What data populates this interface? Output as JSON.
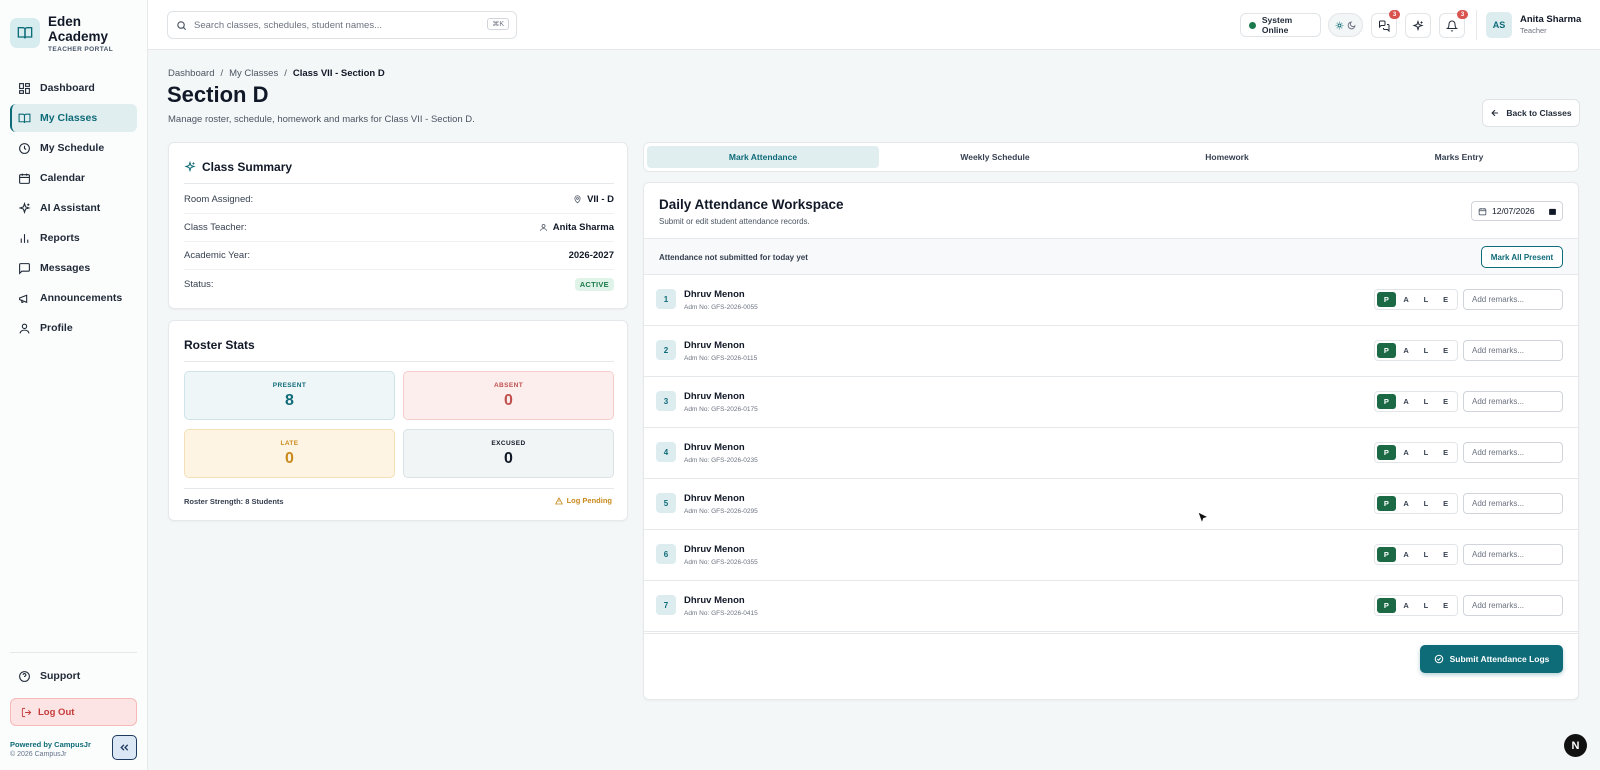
{
  "brand": {
    "name_line1": "Eden",
    "name_line2": "Academy",
    "subtitle": "TEACHER PORTAL"
  },
  "sidebar": {
    "items": [
      {
        "label": "Dashboard",
        "icon": "grid-icon",
        "active": false
      },
      {
        "label": "My Classes",
        "icon": "book-icon",
        "active": true
      },
      {
        "label": "My Schedule",
        "icon": "clock-icon",
        "active": false
      },
      {
        "label": "Calendar",
        "icon": "calendar-icon",
        "active": false
      },
      {
        "label": "AI Assistant",
        "icon": "sparkles-icon",
        "active": false
      },
      {
        "label": "Reports",
        "icon": "bar-chart-icon",
        "active": false
      },
      {
        "label": "Messages",
        "icon": "message-icon",
        "active": false
      },
      {
        "label": "Announcements",
        "icon": "megaphone-icon",
        "active": false
      },
      {
        "label": "Profile",
        "icon": "user-icon",
        "active": false
      }
    ],
    "support": "Support",
    "logout": "Log Out",
    "powered": "Powered by CampusJr",
    "copyright": "© 2026 CampusJr"
  },
  "topbar": {
    "search_placeholder": "Search classes, schedules, student names...",
    "shortcut": "⌘K",
    "system_status": "System Online",
    "messages_badge": "3",
    "notifications_badge": "3",
    "user": {
      "initials": "AS",
      "name": "Anita Sharma",
      "role": "Teacher"
    }
  },
  "page": {
    "breadcrumbs": [
      "Dashboard",
      "My Classes",
      "Class VII - Section D"
    ],
    "title": "Section D",
    "subtitle": "Manage roster, schedule, homework and marks for Class VII - Section D.",
    "back_button": "Back to Classes"
  },
  "class_summary": {
    "title": "Class Summary",
    "rows": [
      {
        "label": "Room Assigned:",
        "value": "VII - D"
      },
      {
        "label": "Class Teacher:",
        "value": "Anita Sharma"
      },
      {
        "label": "Academic Year:",
        "value": "2026-2027"
      },
      {
        "label": "Status:",
        "value": "ACTIVE"
      }
    ]
  },
  "roster_stats": {
    "title": "Roster Stats",
    "present": {
      "label": "PRESENT",
      "value": "8"
    },
    "absent": {
      "label": "ABSENT",
      "value": "0"
    },
    "late": {
      "label": "LATE",
      "value": "0"
    },
    "excused": {
      "label": "EXCUSED",
      "value": "0"
    },
    "strength": "Roster Strength: 8 Students",
    "log_status": "Log Pending"
  },
  "tabs": [
    {
      "label": "Mark Attendance",
      "active": true
    },
    {
      "label": "Weekly Schedule",
      "active": false
    },
    {
      "label": "Homework",
      "active": false
    },
    {
      "label": "Marks Entry",
      "active": false
    }
  ],
  "workspace": {
    "title": "Daily Attendance Workspace",
    "subtitle": "Submit or edit student attendance records.",
    "date": "12/07/2026",
    "notice": "Attendance not submitted for today yet",
    "mark_all": "Mark All Present",
    "status_options": [
      "P",
      "A",
      "L",
      "E"
    ],
    "remarks_placeholder": "Add remarks...",
    "submit": "Submit Attendance Logs",
    "students": [
      {
        "num": "1",
        "name": "Dhruv Menon",
        "adm": "Adm No: GFS-2026-0055",
        "status": "P"
      },
      {
        "num": "2",
        "name": "Dhruv Menon",
        "adm": "Adm No: GFS-2026-0115",
        "status": "P"
      },
      {
        "num": "3",
        "name": "Dhruv Menon",
        "adm": "Adm No: GFS-2026-0175",
        "status": "P"
      },
      {
        "num": "4",
        "name": "Dhruv Menon",
        "adm": "Adm No: GFS-2026-0235",
        "status": "P"
      },
      {
        "num": "5",
        "name": "Dhruv Menon",
        "adm": "Adm No: GFS-2026-0295",
        "status": "P"
      },
      {
        "num": "6",
        "name": "Dhruv Menon",
        "adm": "Adm No: GFS-2026-0355",
        "status": "P"
      },
      {
        "num": "7",
        "name": "Dhruv Menon",
        "adm": "Adm No: GFS-2026-0415",
        "status": "P"
      }
    ]
  },
  "colors": {
    "accent": "#0e6b78",
    "present": "#1b6a45",
    "danger": "#c43b3b",
    "late": "#c98a1e"
  }
}
